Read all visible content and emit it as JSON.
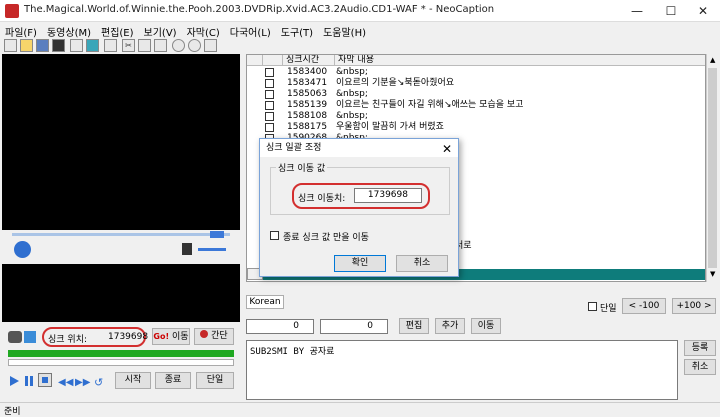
{
  "window": {
    "title": "The.Magical.World.of.Winnie.the.Pooh.2003.DVDRip.Xvid.AC3.2Audio.CD1-WAF * - NeoCaption",
    "minimize": "—",
    "maximize": "☐",
    "close": "✕"
  },
  "menu": [
    "파일(F)",
    "동영상(M)",
    "편집(E)",
    "보기(V)",
    "자막(C)",
    "다국어(L)",
    "도구(T)",
    "도움말(H)"
  ],
  "table": {
    "col_sync": "싱크시간",
    "col_text": "자막 내용",
    "rows": [
      {
        "sync": "1583400",
        "text": "&nbsp;"
      },
      {
        "sync": "1583471",
        "text": "이요르의 기분을↘북돋아줬어요"
      },
      {
        "sync": "1585063",
        "text": "&nbsp;"
      },
      {
        "sync": "1585139",
        "text": "이요르는 친구들이 자길 위해↘애쓰는 모습을 보고"
      },
      {
        "sync": "1588108",
        "text": "&nbsp;"
      },
      {
        "sync": "1588175",
        "text": "우울함이 말끔히 가셔 버렸죠"
      },
      {
        "sync": "1590268",
        "text": "&nbsp;"
      }
    ],
    "partial_text": "서로"
  },
  "lang_tab": "Korean",
  "right_controls": {
    "single_label": "단일",
    "minus100": "< -100",
    "plus100": "+100 >"
  },
  "edit_row": {
    "val1": "0",
    "val2": "0",
    "edit_btn": "편집",
    "add_btn": "추가",
    "move_btn": "이동"
  },
  "editor_text": "SUB2SMI BY 공자료",
  "side_buttons": {
    "register": "등록",
    "cancel": "취소"
  },
  "sync_pos": {
    "label": "싱크 위치:",
    "value": "1739698",
    "move_btn": "이동",
    "simple_btn": "간단"
  },
  "bottom_buttons": {
    "start": "시작",
    "end": "종료",
    "single": "단일"
  },
  "status": "준비",
  "dialog": {
    "title": "싱크 일괄 조정",
    "group_label": "싱크 이동 값",
    "move_label": "싱크 이동치:",
    "move_value": "1739698",
    "checkbox_label": "종료 싱크 값 만을 이동",
    "ok": "확인",
    "cancel": "취소"
  },
  "colors": {
    "accent_green": "#1fa821",
    "highlight_red": "#d32f2f",
    "teal_bar": "#0e7c7b"
  }
}
